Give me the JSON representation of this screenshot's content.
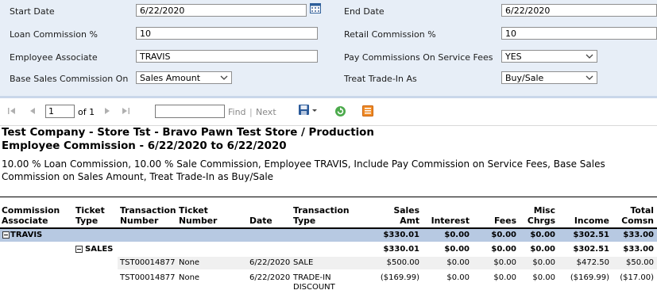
{
  "params": {
    "start_date": {
      "label": "Start Date",
      "value": "6/22/2020"
    },
    "end_date": {
      "label": "End Date",
      "value": "6/22/2020"
    },
    "loan_commission": {
      "label": "Loan Commission %",
      "value": "10"
    },
    "retail_commission": {
      "label": "Retail Commission %",
      "value": "10"
    },
    "employee_associate": {
      "label": "Employee Associate",
      "value": "TRAVIS"
    },
    "pay_commissions_service_fees": {
      "label": "Pay Commissions On Service Fees",
      "value": "YES"
    },
    "base_sales_commission_on": {
      "label": "Base Sales Commission On",
      "value": "Sales Amount"
    },
    "treat_trade_in_as": {
      "label": "Treat Trade-In As",
      "value": "Buy/Sale"
    }
  },
  "toolbar": {
    "page_value": "1",
    "of_pages": "of 1",
    "find_label": "Find",
    "separator": "|",
    "next_label": "Next"
  },
  "report": {
    "title_line1": "Test Company - Store Tst - Bravo Pawn Test Store / Production",
    "title_line2": "Employee Commission - 6/22/2020 to 6/22/2020",
    "description": "10.00 % Loan Commission, 10.00 % Sale Commission, Employee TRAVIS, Include Pay Commission on Service Fees, Base Sales Commission on Sales Amount, Treat Trade-In as Buy/Sale",
    "headers": {
      "commission_associate": [
        "Commission",
        "Associate"
      ],
      "ticket_type": [
        "Ticket",
        "Type"
      ],
      "transaction_number": [
        "Transaction",
        "Number"
      ],
      "ticket_number": [
        "Ticket",
        "Number"
      ],
      "date": [
        "",
        "Date"
      ],
      "transaction_type": [
        "Transaction",
        "Type"
      ],
      "sales_amt": [
        "Sales",
        "Amt"
      ],
      "interest": [
        "",
        "Interest"
      ],
      "fees": [
        "",
        "Fees"
      ],
      "misc_chrgs": [
        "Misc",
        "Chrgs"
      ],
      "income": [
        "",
        "Income"
      ],
      "total_comsn": [
        "Total",
        "Comsn"
      ]
    },
    "group": {
      "associate": "TRAVIS",
      "sales_amt": "$330.01",
      "interest": "$0.00",
      "fees": "$0.00",
      "misc": "$0.00",
      "income": "$302.51",
      "total": "$33.00"
    },
    "subgroup": {
      "ticket_type": "SALES",
      "sales_amt": "$330.01",
      "interest": "$0.00",
      "fees": "$0.00",
      "misc": "$0.00",
      "income": "$302.51",
      "total": "$33.00"
    },
    "rows": [
      {
        "transaction_number": "TST00014877",
        "ticket_number": "None",
        "date": "6/22/2020",
        "transaction_type": [
          "SALE"
        ],
        "sales_amt": "$500.00",
        "interest": "$0.00",
        "fees": "$0.00",
        "misc": "$0.00",
        "income": "$472.50",
        "total": "$50.00"
      },
      {
        "transaction_number": "TST00014877",
        "ticket_number": "None",
        "date": "6/22/2020",
        "transaction_type": [
          "TRADE-IN",
          "DISCOUNT"
        ],
        "sales_amt": "($169.99)",
        "interest": "$0.00",
        "fees": "$0.00",
        "misc": "$0.00",
        "income": "($169.99)",
        "total": "($17.00)"
      }
    ]
  },
  "colors": {
    "panel_bg": "#e7eef7",
    "group_row_bg": "#b7c9e2",
    "detail_row_bg": "#f0f0f0"
  }
}
